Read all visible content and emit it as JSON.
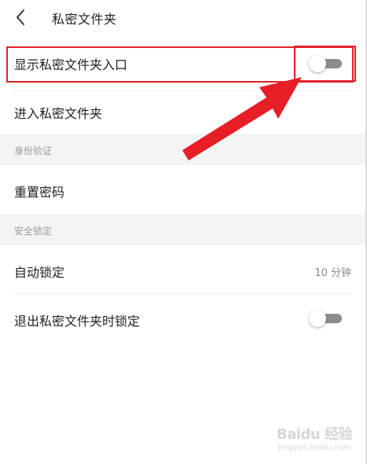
{
  "header": {
    "back_icon": "chevron-left-icon",
    "title": "私密文件夹"
  },
  "rows": {
    "show_entry": {
      "label": "显示私密文件夹入口",
      "toggle_on": false
    },
    "enter_folder": {
      "label": "进入私密文件夹"
    },
    "reset_password": {
      "label": "重置密码"
    },
    "auto_lock": {
      "label": "自动锁定",
      "value": "10 分钟"
    },
    "lock_on_exit": {
      "label": "退出私密文件夹时锁定",
      "toggle_on": false
    }
  },
  "sections": {
    "identity": "身份验证",
    "security_lock": "安全锁定"
  },
  "annotation": {
    "color": "#e0202a"
  },
  "watermark": {
    "logo": "Baidu 经验",
    "url": "jingyan.baidu.com"
  }
}
